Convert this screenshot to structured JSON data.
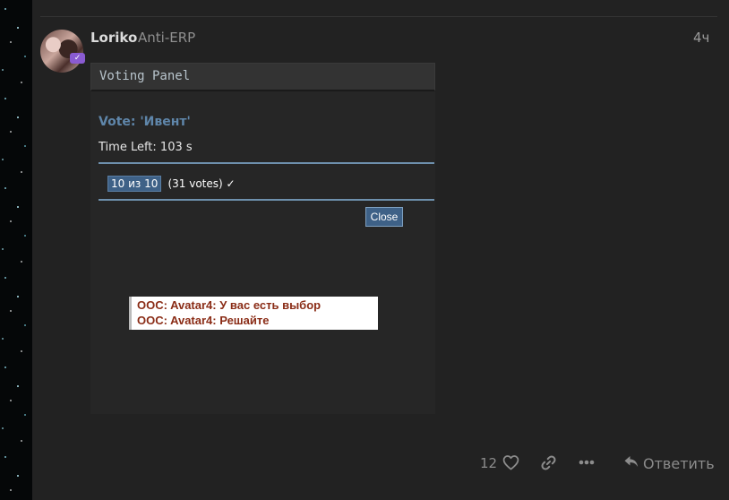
{
  "post": {
    "username": "Loriko",
    "user_title": "Anti-ERP",
    "age": "4ч",
    "avatar_badge": "✓"
  },
  "screenshot": {
    "window_title": "Voting Panel",
    "vote_heading": "Vote: 'Ивент'",
    "time_left": "Time Left: 103 s",
    "option": {
      "label": "10 из 10",
      "votes": "(31 votes) ✓"
    },
    "close_label": "Close",
    "chat": [
      "OOC: Avatar4: У вас есть выбор",
      "OOC: Avatar4: Решайте"
    ]
  },
  "actions": {
    "like_count": "12",
    "reply_label": "Ответить"
  },
  "icons": {
    "heart": "heart-icon",
    "link": "link-icon",
    "more": "ellipsis-icon",
    "reply": "reply-arrow-icon"
  },
  "colors": {
    "background": "#222222",
    "accent_blue": "#3e6187",
    "heading_blue": "#5f86aa",
    "ooc_text": "#8a2c16"
  }
}
